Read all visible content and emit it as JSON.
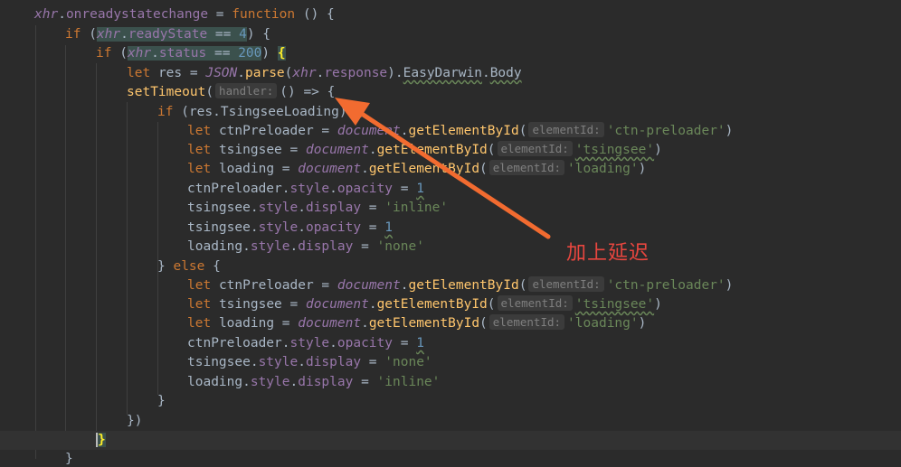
{
  "annotation": {
    "label": "加上延迟",
    "color": "#f26b30"
  },
  "param_hints": {
    "handler": "handler:",
    "elementId": "elementId:"
  },
  "code": {
    "xhr": "xhr",
    "onreadystatechange": "onreadystatechange",
    "function": "function",
    "if": "if",
    "else": "else",
    "let": "let",
    "readyState": "readyState",
    "status": "status",
    "num4": "4",
    "num200": "200",
    "num1": "1",
    "res": "res",
    "JSON": "JSON",
    "parse": "parse",
    "response": "response",
    "EasyDarwin": "EasyDarwin",
    "Body": "Body",
    "setTimeout": "setTimeout",
    "TsingseeLoading": "TsingseeLoading",
    "ctnPreloader": "ctnPreloader",
    "tsingsee": "tsingsee",
    "loading": "loading",
    "document": "document",
    "getElementById": "getElementById",
    "style": "style",
    "opacity": "opacity",
    "display": "display",
    "str_ctn": "'ctn-preloader'",
    "str_tsingsee": "'tsingsee'",
    "str_loading": "'loading'",
    "str_inline": "'inline'",
    "str_none": "'none'"
  },
  "colors": {
    "background": "#2b2b2b",
    "keyword": "#cc7832",
    "number": "#6897bb",
    "string": "#6a8759",
    "property": "#9876aa",
    "function": "#ffc66d",
    "default": "#a9b7c6"
  }
}
